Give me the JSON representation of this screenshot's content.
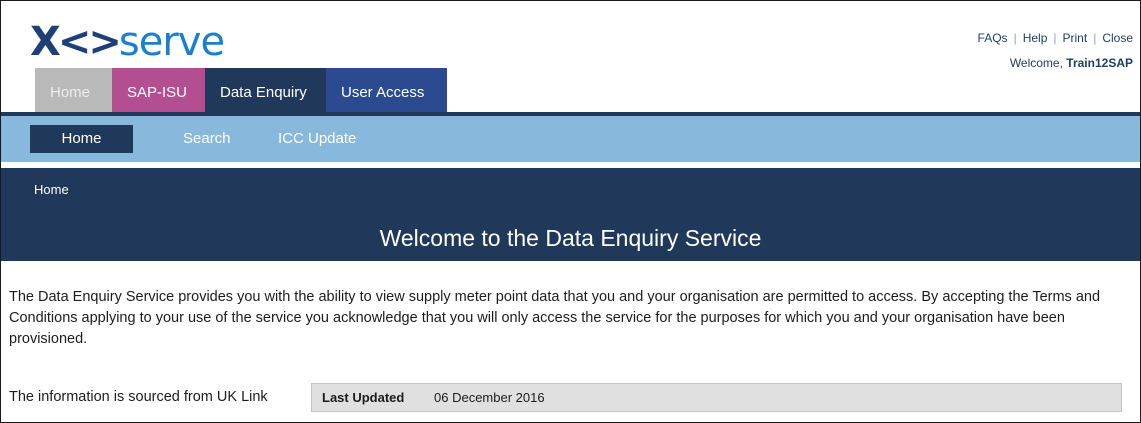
{
  "brand": {
    "logo_mark": "X<>",
    "logo_text": "serve"
  },
  "util_links": [
    "FAQs",
    "Help",
    "Print",
    "Close"
  ],
  "user": {
    "welcome_prefix": "Welcome,",
    "username": "Train12SAP"
  },
  "main_tabs": [
    {
      "label": "Home",
      "color": "#b9b9b9"
    },
    {
      "label": "SAP-ISU",
      "color": "#b34e91"
    },
    {
      "label": "Data Enquiry",
      "color": "#20395a",
      "active": true
    },
    {
      "label": "User Access",
      "color": "#2c4a90"
    }
  ],
  "sub_nav": [
    {
      "label": "Home",
      "active": true
    },
    {
      "label": "Search"
    },
    {
      "label": "ICC Update"
    }
  ],
  "breadcrumb": "Home",
  "page_title": "Welcome to the Data Enquiry Service",
  "intro_text": "The Data Enquiry Service provides you with the ability to view supply meter point data that you and your organisation are permitted to access. By accepting the Terms and Conditions applying to your use of the service you acknowledge that you will only access the service for the purposes for which you and your organisation have been provisioned.",
  "source": {
    "text": "The information is sourced from UK Link",
    "updated_label": "Last Updated",
    "updated_value": "06 December 2016"
  },
  "colors": {
    "navy": "#20395a",
    "light_blue": "#88b9dc",
    "brand_blue": "#1b7fcf"
  }
}
